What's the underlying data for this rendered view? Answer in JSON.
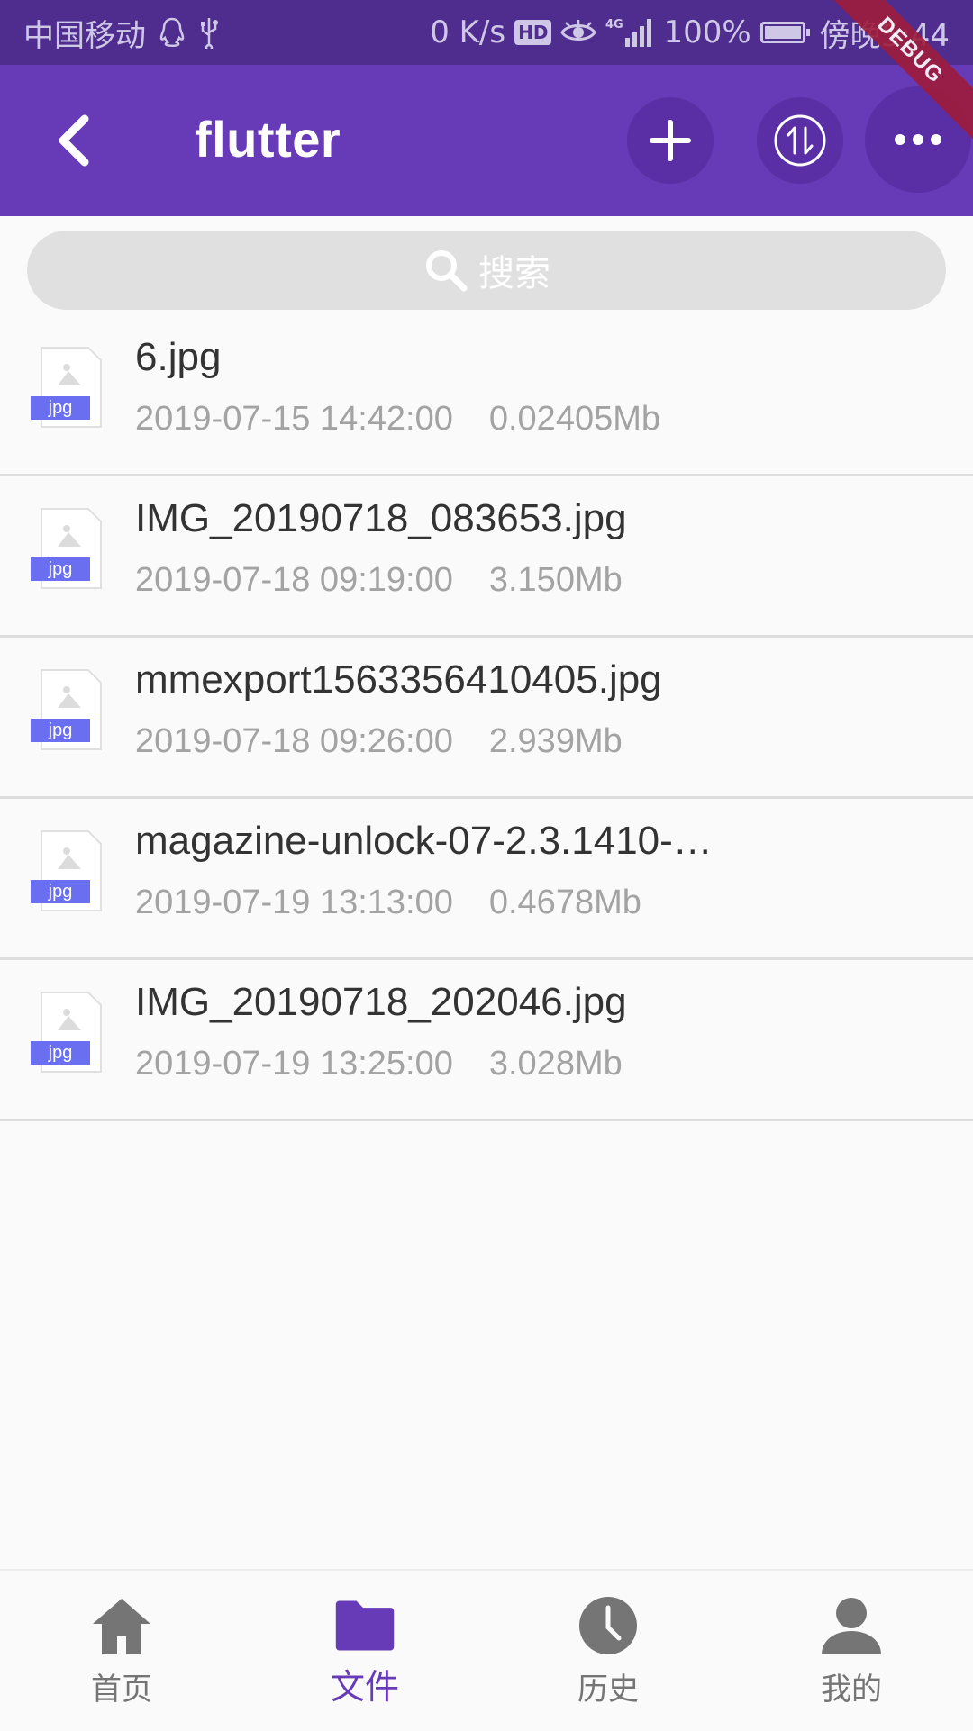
{
  "status_bar": {
    "carrier": "中国移动",
    "net_speed": "0 K/s",
    "hd": "HD",
    "network": "4G",
    "battery": "100%",
    "time": "傍晚5:44"
  },
  "app_bar": {
    "title": "flutter"
  },
  "debug_banner": "DEBUG",
  "search": {
    "placeholder": "搜索"
  },
  "files": [
    {
      "name": "6.jpg",
      "date": "2019-07-15 14:42:00",
      "size": "0.02405Mb",
      "type": "jpg"
    },
    {
      "name": "IMG_20190718_083653.jpg",
      "date": "2019-07-18 09:19:00",
      "size": "3.150Mb",
      "type": "jpg"
    },
    {
      "name": "mmexport1563356410405.jpg",
      "date": "2019-07-18 09:26:00",
      "size": "2.939Mb",
      "type": "jpg"
    },
    {
      "name": "magazine-unlock-07-2.3.1410-…",
      "date": "2019-07-19 13:13:00",
      "size": "0.4678Mb",
      "type": "jpg"
    },
    {
      "name": "IMG_20190718_202046.jpg",
      "date": "2019-07-19 13:25:00",
      "size": "3.028Mb",
      "type": "jpg"
    }
  ],
  "bottom_nav": [
    {
      "label": "首页",
      "icon": "home-icon"
    },
    {
      "label": "文件",
      "icon": "folder-icon",
      "active": true
    },
    {
      "label": "历史",
      "icon": "clock-icon"
    },
    {
      "label": "我的",
      "icon": "person-icon"
    }
  ],
  "colors": {
    "primary": "#673ab7",
    "status_bar": "#4f2d8f",
    "badge": "#6a6ef0",
    "muted_text": "#a3a3a3",
    "nav_inactive": "#757575"
  }
}
